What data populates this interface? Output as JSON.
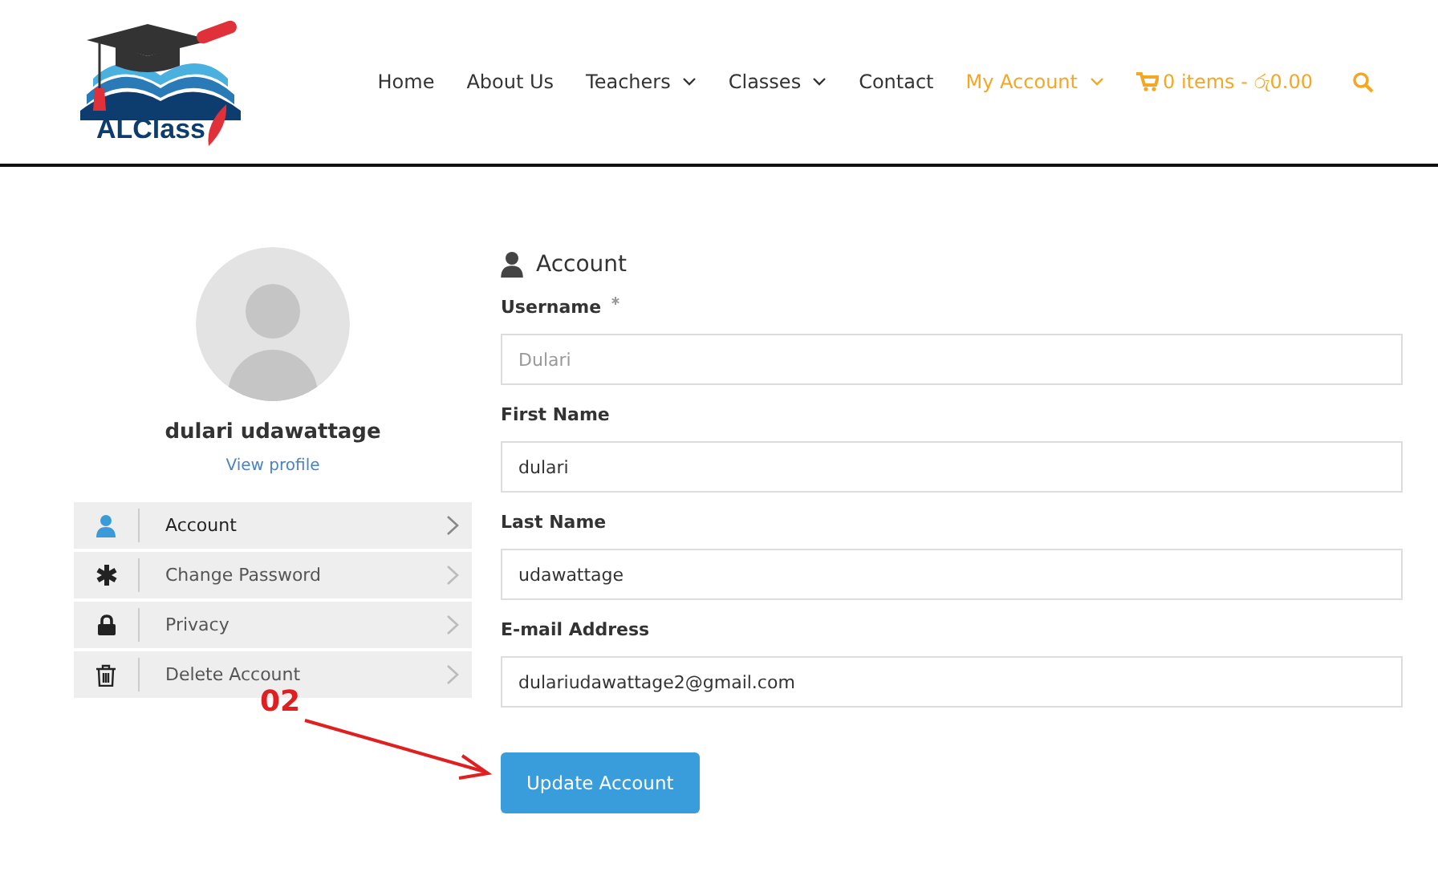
{
  "header": {
    "logo_text": "ALClass",
    "nav": [
      {
        "label": "Home",
        "dropdown": false,
        "selected": false
      },
      {
        "label": "About Us",
        "dropdown": false,
        "selected": false
      },
      {
        "label": "Teachers",
        "dropdown": true,
        "selected": false
      },
      {
        "label": "Classes",
        "dropdown": true,
        "selected": false
      },
      {
        "label": "Contact",
        "dropdown": false,
        "selected": false
      },
      {
        "label": "My Account",
        "dropdown": true,
        "selected": true
      }
    ],
    "cart": "0 items - රු0.00"
  },
  "profile": {
    "name": "dulari udawattage",
    "link": "View profile"
  },
  "menu": [
    {
      "kind": "user",
      "label": "Account",
      "selected": true
    },
    {
      "kind": "asterisk",
      "label": "Change Password",
      "selected": false
    },
    {
      "kind": "lock",
      "label": "Privacy",
      "selected": false
    },
    {
      "kind": "trash",
      "label": "Delete Account",
      "selected": false
    }
  ],
  "form": {
    "title": "Account",
    "fields": [
      {
        "label": "Username",
        "required": true,
        "value": "Dulari",
        "disabled": true
      },
      {
        "label": "First Name",
        "required": false,
        "value": "dulari",
        "disabled": false
      },
      {
        "label": "Last Name",
        "required": false,
        "value": "udawattage",
        "disabled": false
      },
      {
        "label": "E-mail Address",
        "required": false,
        "value": "dulariudawattage2@gmail.com",
        "disabled": false
      }
    ],
    "button": "Update Account"
  },
  "annotation": {
    "label": "02"
  }
}
